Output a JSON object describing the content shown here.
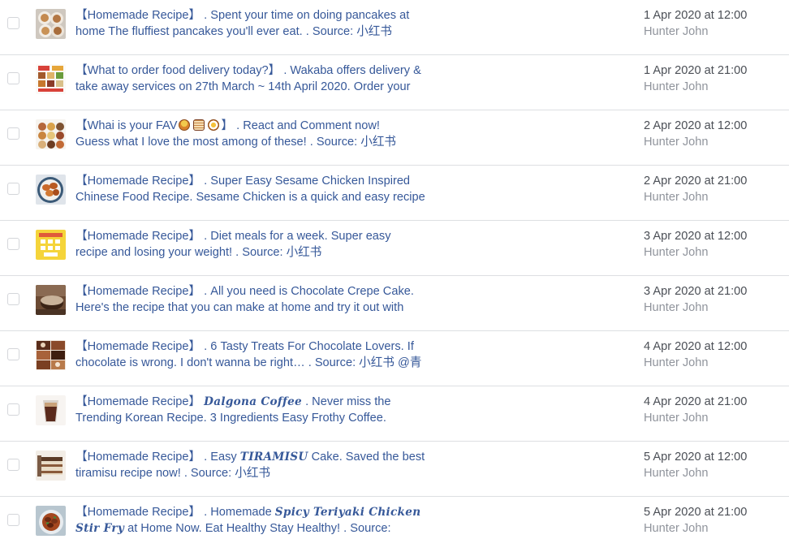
{
  "posts": [
    {
      "line1": [
        {
          "t": "【Homemade Recipe】 . Spent your time on doing pancakes at"
        }
      ],
      "line2": [
        {
          "t": "home The fluffiest pancakes you'll ever eat. . Source: 小红书"
        }
      ],
      "date": "1 Apr 2020 at 12:00",
      "author": "Hunter John",
      "thumb": "pancakes"
    },
    {
      "line1": [
        {
          "t": "【What to order food delivery today?】 . Wakaba offers delivery &"
        }
      ],
      "line2": [
        {
          "t": "take away services on 27th March ~ 14th April 2020. Order your"
        }
      ],
      "date": "1 Apr 2020 at 21:00",
      "author": "Hunter John",
      "thumb": "menu"
    },
    {
      "line1": [
        {
          "t": "【Whai is your FAV"
        },
        {
          "emoji": "curry"
        },
        {
          "emoji": "noodles"
        },
        {
          "emoji": "egg"
        },
        {
          "t": "】 . React and Comment now!"
        }
      ],
      "line2": [
        {
          "t": "Guess what I love the most among of these! . Source: 小红书"
        }
      ],
      "date": "2 Apr 2020 at 12:00",
      "author": "Hunter John",
      "thumb": "foodgrid"
    },
    {
      "line1": [
        {
          "t": "【Homemade Recipe】 . Super Easy Sesame Chicken Inspired"
        }
      ],
      "line2": [
        {
          "t": "Chinese Food Recipe. Sesame Chicken is a quick and easy recipe"
        }
      ],
      "date": "2 Apr 2020 at 21:00",
      "author": "Hunter John",
      "thumb": "chicken"
    },
    {
      "line1": [
        {
          "t": "【Homemade Recipe】 . Diet meals for a week. Super easy"
        }
      ],
      "line2": [
        {
          "t": "recipe and losing your weight! . Source: 小红书"
        }
      ],
      "date": "3 Apr 2020 at 12:00",
      "author": "Hunter John",
      "thumb": "diet"
    },
    {
      "line1": [
        {
          "t": "【Homemade Recipe】 . All you need is Chocolate Crepe Cake."
        }
      ],
      "line2": [
        {
          "t": "Here's the recipe that you can make at home and try it out with"
        }
      ],
      "date": "3 Apr 2020 at 21:00",
      "author": "Hunter John",
      "thumb": "crepe"
    },
    {
      "line1": [
        {
          "t": "【Homemade Recipe】 . 6 Tasty Treats For Chocolate Lovers. If"
        }
      ],
      "line2": [
        {
          "t": "chocolate is wrong. I don't wanna be right… . Source: 小红书 @青"
        }
      ],
      "date": "4 Apr 2020 at 12:00",
      "author": "Hunter John",
      "thumb": "chocolates"
    },
    {
      "line1": [
        {
          "t": "【Homemade Recipe】 "
        },
        {
          "em": "Dalgona Coffee"
        },
        {
          "t": " . Never miss the"
        }
      ],
      "line2": [
        {
          "t": "Trending Korean Recipe. 3 Ingredients Easy Frothy Coffee."
        }
      ],
      "date": "4 Apr 2020 at 21:00",
      "author": "Hunter John",
      "thumb": "coffee"
    },
    {
      "line1": [
        {
          "t": "【Homemade Recipe】 . Easy "
        },
        {
          "em": "TIRAMISU"
        },
        {
          "t": " Cake. Saved the best"
        }
      ],
      "line2": [
        {
          "t": "tiramisu recipe now! . Source: 小红书"
        }
      ],
      "date": "5 Apr 2020 at 12:00",
      "author": "Hunter John",
      "thumb": "tiramisu"
    },
    {
      "line1": [
        {
          "t": "【Homemade Recipe】 . Homemade "
        },
        {
          "em": "Spicy Teriyaki Chicken"
        }
      ],
      "line2": [
        {
          "em": "Stir Fry"
        },
        {
          "t": " at Home Now. Eat Healthy Stay Healthy! . Source:"
        }
      ],
      "date": "5 Apr 2020 at 21:00",
      "author": "Hunter John",
      "thumb": "teriyaki"
    }
  ]
}
